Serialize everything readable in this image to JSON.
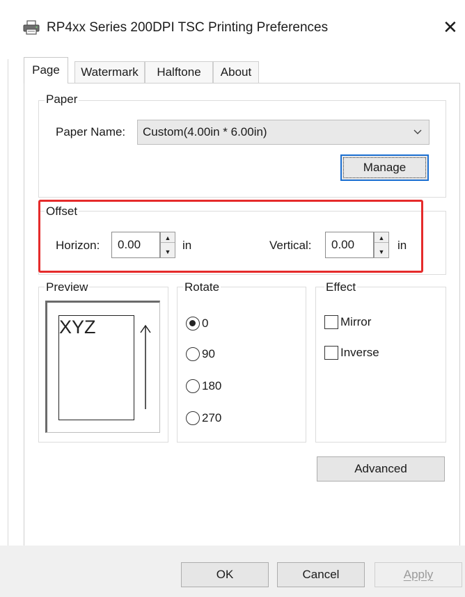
{
  "window": {
    "title": "RP4xx Series 200DPI TSC Printing Preferences",
    "close_glyph": "✕",
    "icon": "printer-icon"
  },
  "tabs": [
    {
      "label": "Page",
      "active": true
    },
    {
      "label": "Watermark",
      "active": false
    },
    {
      "label": "Halftone",
      "active": false
    },
    {
      "label": "About",
      "active": false
    }
  ],
  "paper": {
    "group_label": "Paper",
    "name_label": "Paper Name:",
    "name_value": "Custom(4.00in * 6.00in)",
    "manage_label": "Manage"
  },
  "offset": {
    "group_label": "Offset",
    "horizon_label": "Horizon:",
    "horizon_value": "0.00",
    "horizon_unit": "in",
    "vertical_label": "Vertical:",
    "vertical_value": "0.00",
    "vertical_unit": "in",
    "highlight_color": "#e52b2b"
  },
  "preview": {
    "group_label": "Preview",
    "sample_text": "XYZ"
  },
  "rotate": {
    "group_label": "Rotate",
    "options": [
      {
        "label": "0",
        "checked": true
      },
      {
        "label": "90",
        "checked": false
      },
      {
        "label": "180",
        "checked": false
      },
      {
        "label": "270",
        "checked": false
      }
    ]
  },
  "effect": {
    "group_label": "Effect",
    "options": [
      {
        "label": "Mirror",
        "checked": false
      },
      {
        "label": "Inverse",
        "checked": false
      }
    ]
  },
  "advanced_label": "Advanced",
  "footer": {
    "ok_label": "OK",
    "cancel_label": "Cancel",
    "apply_label": "Apply"
  },
  "colors": {
    "focus_border": "#1b6fd1",
    "disabled_text": "#9a9a9a"
  }
}
